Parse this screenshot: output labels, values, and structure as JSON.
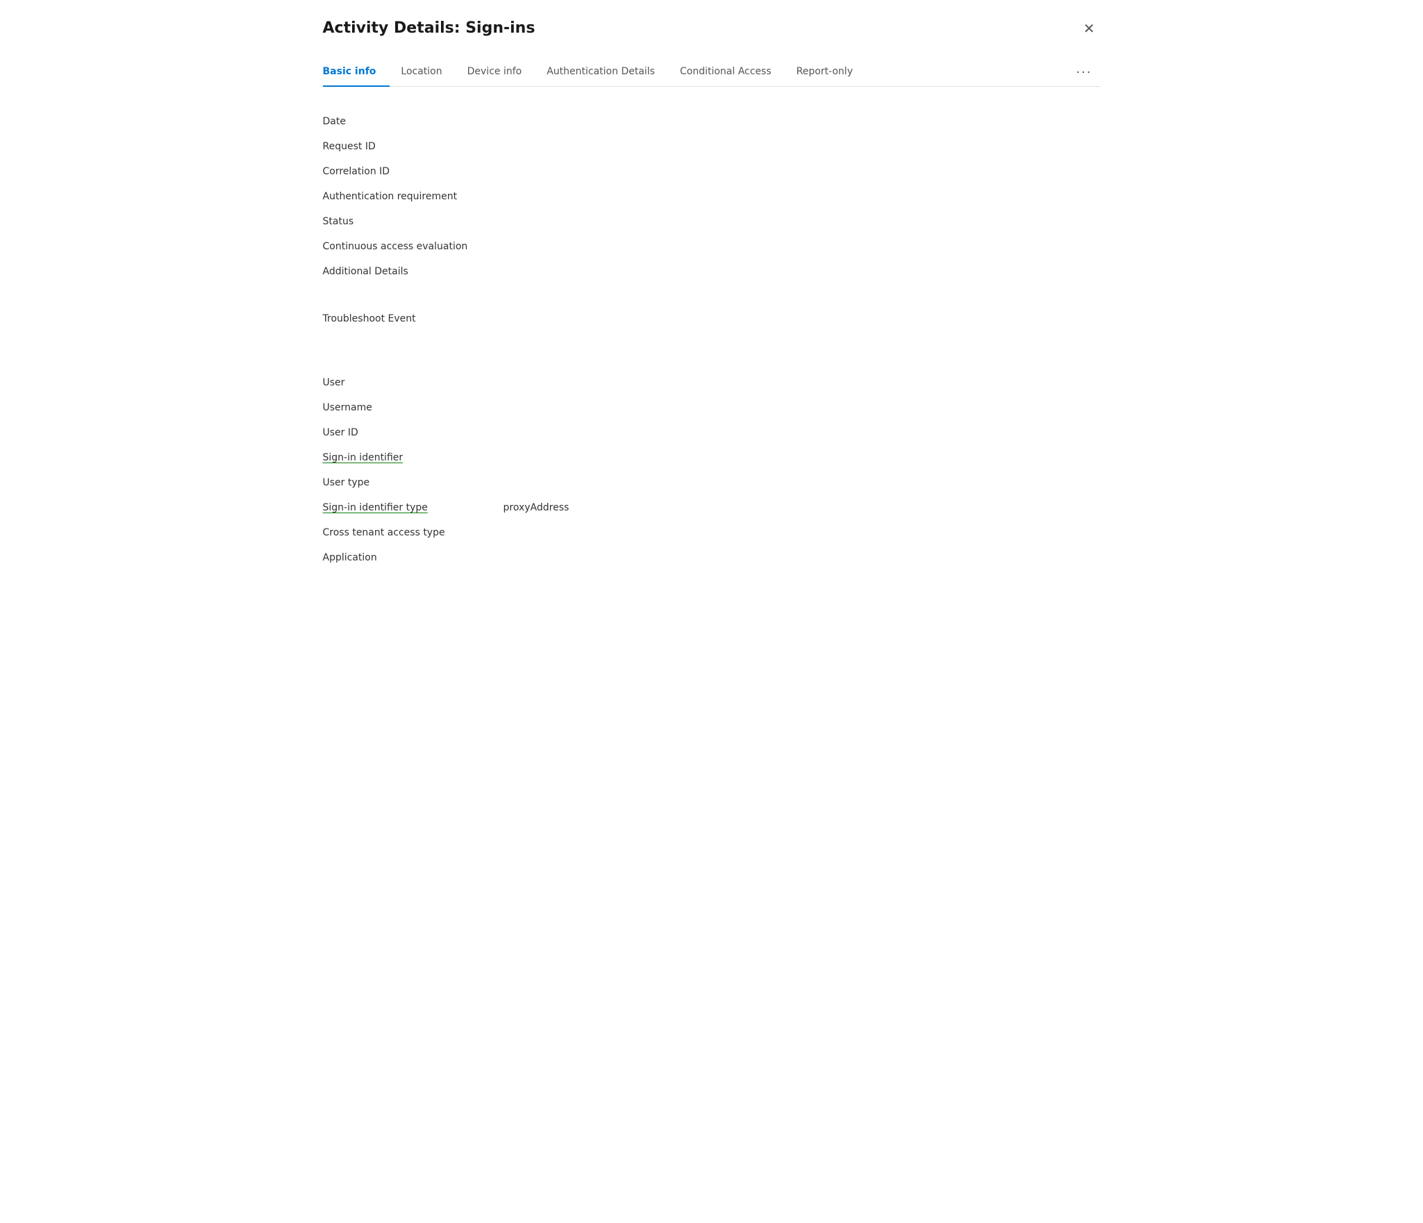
{
  "panel": {
    "title": "Activity Details: Sign-ins",
    "close_label": "✕"
  },
  "tabs": [
    {
      "id": "basic-info",
      "label": "Basic info",
      "active": true
    },
    {
      "id": "location",
      "label": "Location",
      "active": false
    },
    {
      "id": "device-info",
      "label": "Device info",
      "active": false
    },
    {
      "id": "authentication-details",
      "label": "Authentication Details",
      "active": false
    },
    {
      "id": "conditional-access",
      "label": "Conditional Access",
      "active": false
    },
    {
      "id": "report-only",
      "label": "Report-only",
      "active": false
    }
  ],
  "tab_more_label": "···",
  "fields": [
    {
      "id": "date",
      "label": "Date",
      "value": "",
      "underlined": false
    },
    {
      "id": "request-id",
      "label": "Request ID",
      "value": "",
      "underlined": false
    },
    {
      "id": "correlation-id",
      "label": "Correlation ID",
      "value": "",
      "underlined": false
    },
    {
      "id": "auth-requirement",
      "label": "Authentication requirement",
      "value": "",
      "underlined": false
    },
    {
      "id": "status",
      "label": "Status",
      "value": "",
      "underlined": false
    },
    {
      "id": "continuous-access",
      "label": "Continuous access evaluation",
      "value": "",
      "underlined": false
    },
    {
      "id": "additional-details",
      "label": "Additional Details",
      "value": "",
      "underlined": false
    }
  ],
  "troubleshoot": {
    "label": "Troubleshoot Event",
    "value": ""
  },
  "user_fields": [
    {
      "id": "user",
      "label": "User",
      "value": "",
      "underlined": false
    },
    {
      "id": "username",
      "label": "Username",
      "value": "",
      "underlined": false
    },
    {
      "id": "user-id",
      "label": "User ID",
      "value": "",
      "underlined": false
    },
    {
      "id": "signin-identifier",
      "label": "Sign-in identifier",
      "value": "",
      "underlined": true
    },
    {
      "id": "user-type",
      "label": "User type",
      "value": "",
      "underlined": false
    },
    {
      "id": "signin-identifier-type",
      "label": "Sign-in identifier type",
      "value": "proxyAddress",
      "underlined": true
    },
    {
      "id": "cross-tenant-access-type",
      "label": "Cross tenant access type",
      "value": "",
      "underlined": false
    },
    {
      "id": "application",
      "label": "Application",
      "value": "",
      "underlined": false
    }
  ]
}
